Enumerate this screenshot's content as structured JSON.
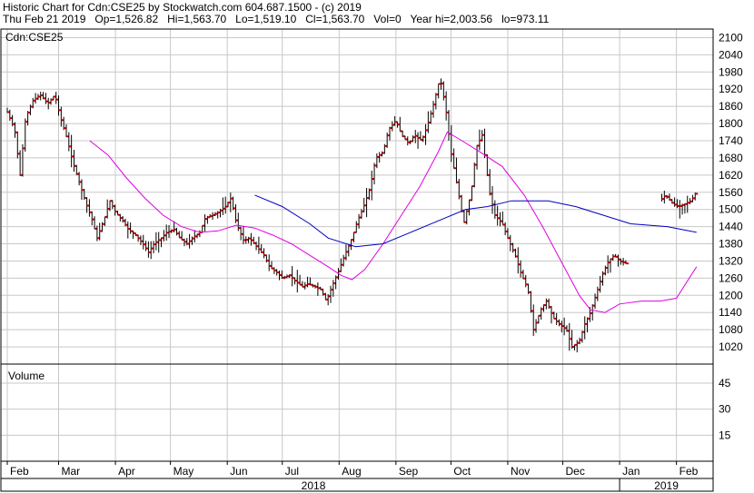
{
  "header": {
    "line1": "Historic Chart for Cdn:CSE25 by Stockwatch.com 604.687.1500 - (c) 2019",
    "line2": "Thu Feb 21 2019   Op=1,526.82   Hi=1,563.70   Lo=1,519.10   Cl=1,563.70   Vol=0   Year hi=2,003.56   lo=973.11"
  },
  "chart_data": {
    "type": "ohlc",
    "symbol_label": "Cdn:CSE25",
    "price_axis": {
      "ylim": [
        960,
        2130
      ],
      "ticks": [
        2100,
        2040,
        1980,
        1920,
        1860,
        1800,
        1740,
        1680,
        1620,
        1560,
        1500,
        1440,
        1380,
        1320,
        1260,
        1200,
        1140,
        1080,
        1020
      ],
      "grid": true
    },
    "volume_axis": {
      "label": "Volume",
      "ylim": [
        0,
        56
      ],
      "ticks": [
        45,
        30,
        15
      ],
      "grid": true
    },
    "x_axis": {
      "months": [
        {
          "label": "Feb",
          "day": 0
        },
        {
          "label": "Mar",
          "day": 28
        },
        {
          "label": "Apr",
          "day": 59
        },
        {
          "label": "May",
          "day": 89
        },
        {
          "label": "Jun",
          "day": 120
        },
        {
          "label": "Jul",
          "day": 150
        },
        {
          "label": "Aug",
          "day": 181
        },
        {
          "label": "Sep",
          "day": 212
        },
        {
          "label": "Oct",
          "day": 242
        },
        {
          "label": "Nov",
          "day": 273
        },
        {
          "label": "Dec",
          "day": 303
        },
        {
          "label": "Jan",
          "day": 334
        },
        {
          "label": "Feb",
          "day": 365
        }
      ],
      "years": [
        {
          "label": "2018",
          "from": 0,
          "to": 334
        },
        {
          "label": "2019",
          "from": 334,
          "to": 385
        }
      ],
      "range_days": [
        0,
        385
      ]
    },
    "price_series": [
      {
        "day": 0,
        "close": 1840
      },
      {
        "day": 4,
        "close": 1780
      },
      {
        "day": 7,
        "close": 1620
      },
      {
        "day": 10,
        "close": 1820
      },
      {
        "day": 14,
        "close": 1880
      },
      {
        "day": 18,
        "close": 1900
      },
      {
        "day": 22,
        "close": 1870
      },
      {
        "day": 26,
        "close": 1900
      },
      {
        "day": 29,
        "close": 1820
      },
      {
        "day": 32,
        "close": 1760
      },
      {
        "day": 36,
        "close": 1660
      },
      {
        "day": 39,
        "close": 1600
      },
      {
        "day": 43,
        "close": 1520
      },
      {
        "day": 46,
        "close": 1470
      },
      {
        "day": 49,
        "close": 1400
      },
      {
        "day": 53,
        "close": 1470
      },
      {
        "day": 56,
        "close": 1530
      },
      {
        "day": 59,
        "close": 1490
      },
      {
        "day": 63,
        "close": 1460
      },
      {
        "day": 66,
        "close": 1430
      },
      {
        "day": 70,
        "close": 1410
      },
      {
        "day": 74,
        "close": 1380
      },
      {
        "day": 77,
        "close": 1350
      },
      {
        "day": 80,
        "close": 1380
      },
      {
        "day": 84,
        "close": 1400
      },
      {
        "day": 87,
        "close": 1420
      },
      {
        "day": 91,
        "close": 1430
      },
      {
        "day": 94,
        "close": 1400
      },
      {
        "day": 98,
        "close": 1380
      },
      {
        "day": 101,
        "close": 1400
      },
      {
        "day": 105,
        "close": 1420
      },
      {
        "day": 108,
        "close": 1470
      },
      {
        "day": 112,
        "close": 1480
      },
      {
        "day": 115,
        "close": 1490
      },
      {
        "day": 119,
        "close": 1510
      },
      {
        "day": 122,
        "close": 1540
      },
      {
        "day": 125,
        "close": 1450
      },
      {
        "day": 129,
        "close": 1390
      },
      {
        "day": 132,
        "close": 1400
      },
      {
        "day": 136,
        "close": 1370
      },
      {
        "day": 140,
        "close": 1340
      },
      {
        "day": 143,
        "close": 1300
      },
      {
        "day": 147,
        "close": 1280
      },
      {
        "day": 150,
        "close": 1260
      },
      {
        "day": 154,
        "close": 1270
      },
      {
        "day": 157,
        "close": 1250
      },
      {
        "day": 161,
        "close": 1230
      },
      {
        "day": 164,
        "close": 1240
      },
      {
        "day": 168,
        "close": 1230
      },
      {
        "day": 171,
        "close": 1220
      },
      {
        "day": 174,
        "close": 1180
      },
      {
        "day": 177,
        "close": 1230
      },
      {
        "day": 181,
        "close": 1290
      },
      {
        "day": 184,
        "close": 1340
      },
      {
        "day": 188,
        "close": 1400
      },
      {
        "day": 191,
        "close": 1460
      },
      {
        "day": 195,
        "close": 1520
      },
      {
        "day": 198,
        "close": 1580
      },
      {
        "day": 201,
        "close": 1680
      },
      {
        "day": 205,
        "close": 1700
      },
      {
        "day": 208,
        "close": 1780
      },
      {
        "day": 212,
        "close": 1810
      },
      {
        "day": 215,
        "close": 1760
      },
      {
        "day": 219,
        "close": 1730
      },
      {
        "day": 222,
        "close": 1760
      },
      {
        "day": 226,
        "close": 1740
      },
      {
        "day": 229,
        "close": 1790
      },
      {
        "day": 233,
        "close": 1880
      },
      {
        "day": 236,
        "close": 1960
      },
      {
        "day": 239,
        "close": 1860
      },
      {
        "day": 242,
        "close": 1700
      },
      {
        "day": 246,
        "close": 1560
      },
      {
        "day": 249,
        "close": 1450
      },
      {
        "day": 253,
        "close": 1560
      },
      {
        "day": 256,
        "close": 1720
      },
      {
        "day": 259,
        "close": 1760
      },
      {
        "day": 263,
        "close": 1560
      },
      {
        "day": 266,
        "close": 1480
      },
      {
        "day": 270,
        "close": 1450
      },
      {
        "day": 273,
        "close": 1400
      },
      {
        "day": 277,
        "close": 1340
      },
      {
        "day": 280,
        "close": 1280
      },
      {
        "day": 284,
        "close": 1220
      },
      {
        "day": 287,
        "close": 1080
      },
      {
        "day": 291,
        "close": 1150
      },
      {
        "day": 294,
        "close": 1180
      },
      {
        "day": 298,
        "close": 1120
      },
      {
        "day": 301,
        "close": 1100
      },
      {
        "day": 305,
        "close": 1080
      },
      {
        "day": 308,
        "close": 1020
      },
      {
        "day": 312,
        "close": 1040
      },
      {
        "day": 315,
        "close": 1100
      },
      {
        "day": 318,
        "close": 1140
      },
      {
        "day": 322,
        "close": 1220
      },
      {
        "day": 325,
        "close": 1280
      },
      {
        "day": 328,
        "close": 1320
      },
      {
        "day": 331,
        "close": 1340
      },
      {
        "day": 334,
        "close": 1320
      },
      {
        "day": 338,
        "close": 1310
      },
      {
        "day": 356,
        "close": 1530
      },
      {
        "day": 359,
        "close": 1550
      },
      {
        "day": 363,
        "close": 1520
      },
      {
        "day": 366,
        "close": 1510
      },
      {
        "day": 370,
        "close": 1520
      },
      {
        "day": 373,
        "close": 1530
      },
      {
        "day": 376,
        "close": 1563.7
      }
    ],
    "ma_pink": {
      "color": "#e000e0",
      "points": [
        [
          45,
          1740
        ],
        [
          55,
          1690
        ],
        [
          65,
          1610
        ],
        [
          75,
          1540
        ],
        [
          85,
          1480
        ],
        [
          95,
          1440
        ],
        [
          105,
          1420
        ],
        [
          115,
          1425
        ],
        [
          125,
          1445
        ],
        [
          135,
          1435
        ],
        [
          145,
          1410
        ],
        [
          155,
          1380
        ],
        [
          165,
          1340
        ],
        [
          175,
          1300
        ],
        [
          182,
          1270
        ],
        [
          188,
          1255
        ],
        [
          195,
          1290
        ],
        [
          205,
          1380
        ],
        [
          215,
          1480
        ],
        [
          225,
          1580
        ],
        [
          235,
          1700
        ],
        [
          240,
          1770
        ],
        [
          248,
          1740
        ],
        [
          258,
          1700
        ],
        [
          270,
          1650
        ],
        [
          282,
          1550
        ],
        [
          292,
          1440
        ],
        [
          302,
          1320
        ],
        [
          312,
          1200
        ],
        [
          318,
          1150
        ],
        [
          326,
          1140
        ],
        [
          334,
          1170
        ],
        [
          346,
          1180
        ],
        [
          356,
          1180
        ],
        [
          365,
          1190
        ],
        [
          376,
          1300
        ]
      ]
    },
    "ma_blue": {
      "color": "#0000c0",
      "points": [
        [
          135,
          1550
        ],
        [
          150,
          1510
        ],
        [
          165,
          1450
        ],
        [
          175,
          1400
        ],
        [
          190,
          1370
        ],
        [
          205,
          1380
        ],
        [
          220,
          1420
        ],
        [
          235,
          1460
        ],
        [
          250,
          1500
        ],
        [
          262,
          1510
        ],
        [
          275,
          1530
        ],
        [
          295,
          1530
        ],
        [
          310,
          1510
        ],
        [
          325,
          1480
        ],
        [
          340,
          1450
        ],
        [
          360,
          1440
        ],
        [
          376,
          1420
        ]
      ]
    },
    "volume": []
  }
}
